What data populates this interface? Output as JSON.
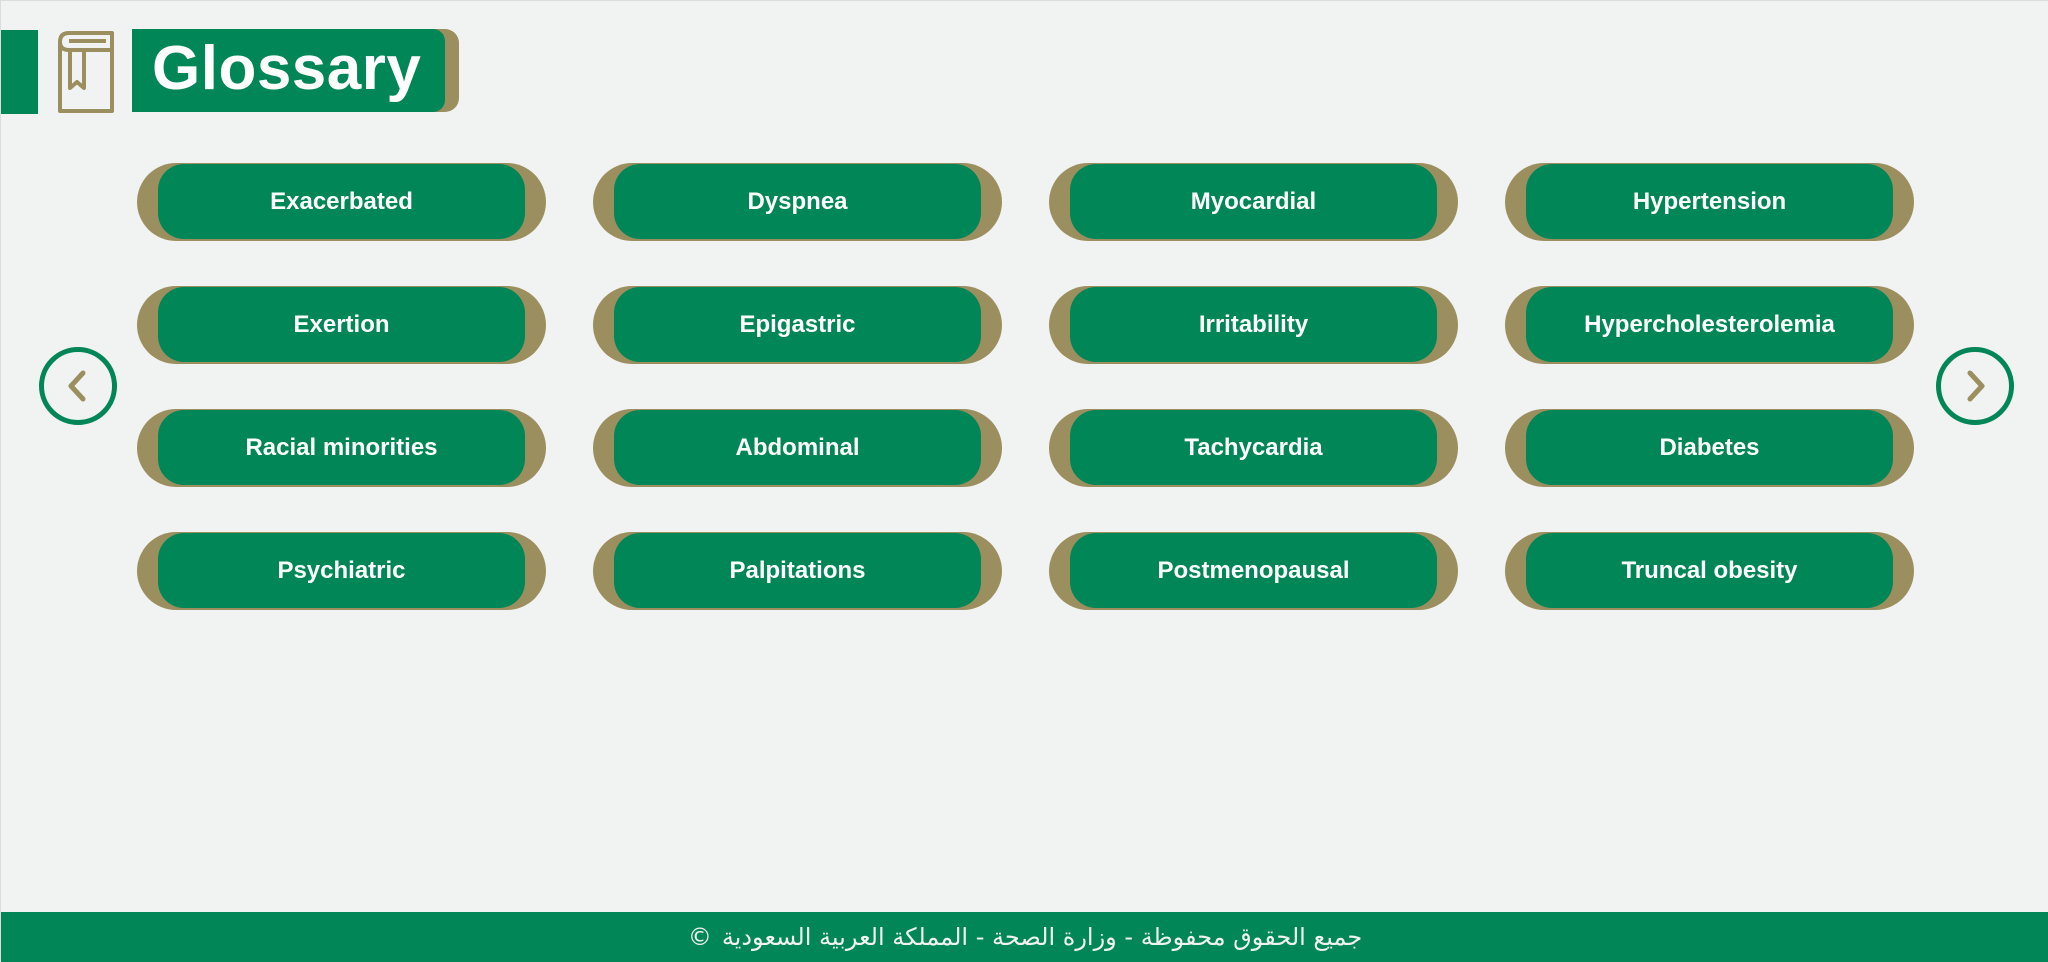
{
  "header": {
    "title": "Glossary",
    "icon": "book-icon"
  },
  "colors": {
    "primary": "#018657",
    "accent": "#9c8f5f",
    "background": "#f1f2f2",
    "text_on_primary": "#ffffff"
  },
  "terms": [
    {
      "label": "Exacerbated"
    },
    {
      "label": "Dyspnea"
    },
    {
      "label": "Myocardial"
    },
    {
      "label": "Hypertension"
    },
    {
      "label": "Exertion"
    },
    {
      "label": "Epigastric"
    },
    {
      "label": "Irritability"
    },
    {
      "label": "Hypercholesterolemia"
    },
    {
      "label": "Racial minorities"
    },
    {
      "label": "Abdominal"
    },
    {
      "label": "Tachycardia"
    },
    {
      "label": "Diabetes"
    },
    {
      "label": "Psychiatric"
    },
    {
      "label": "Palpitations"
    },
    {
      "label": "Postmenopausal"
    },
    {
      "label": "Truncal obesity"
    }
  ],
  "navigation": {
    "prev_icon": "chevron-left-icon",
    "next_icon": "chevron-right-icon"
  },
  "footer": {
    "text": "جميع الحقوق محفوظة - وزارة الصحة - المملكة العربية السعودية",
    "copyright_symbol": "©"
  }
}
